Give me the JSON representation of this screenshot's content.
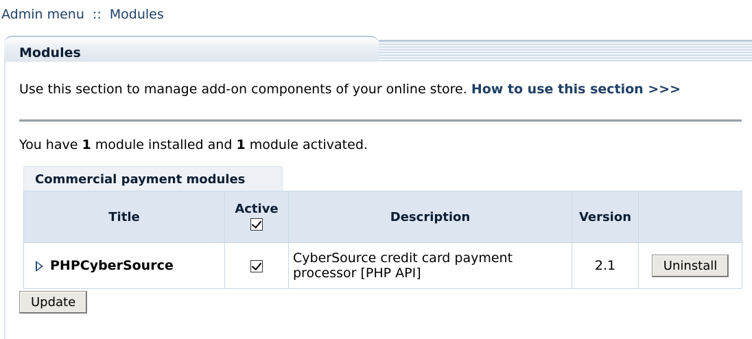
{
  "breadcrumb": {
    "root": "Admin menu",
    "separator": "::",
    "current": "Modules"
  },
  "panel": {
    "title": "Modules"
  },
  "intro": {
    "text": "Use this section to manage add-on components of your online store.",
    "link": "How to use this section >>>"
  },
  "status": {
    "prefix": "You have",
    "installed_count": "1",
    "middle": "module installed and",
    "activated_count": "1",
    "suffix": "module activated."
  },
  "group": {
    "label": "Commercial payment modules"
  },
  "table": {
    "headers": {
      "title": "Title",
      "active": "Active",
      "description": "Description",
      "version": "Version"
    },
    "header_active_checked": true,
    "rows": [
      {
        "title": "PHPCyberSource",
        "active": true,
        "description": "CyberSource credit card payment processor [PHP API]",
        "version": "2.1",
        "action": "Uninstall"
      }
    ]
  },
  "buttons": {
    "update": "Update"
  },
  "colors": {
    "link": "#1f3f66",
    "header_bg": "#dde6f0",
    "border": "#c9d7e6"
  }
}
